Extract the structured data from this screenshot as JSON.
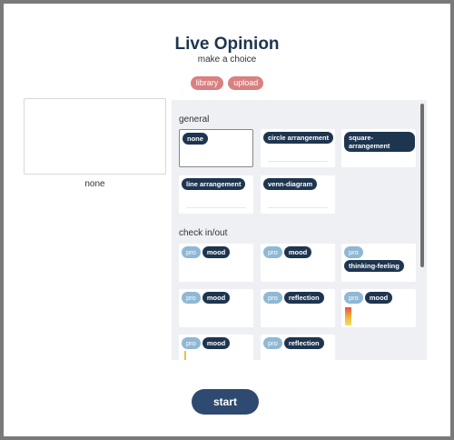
{
  "app": {
    "title": "Live Opinion",
    "subtitle": "make a choice"
  },
  "source_tabs": [
    "library",
    "upload"
  ],
  "preview": {
    "label": "none"
  },
  "sections": [
    {
      "title": "general",
      "cards": [
        {
          "tags": [
            "none"
          ],
          "selected": true
        },
        {
          "tags": [
            "circle arrangement"
          ]
        },
        {
          "tags": [
            "square-arrangement"
          ]
        },
        {
          "tags": [
            "line arrangement"
          ]
        },
        {
          "tags": [
            "venn-diagram"
          ]
        }
      ]
    },
    {
      "title": "check in/out",
      "cards": [
        {
          "tags": [
            "pro",
            "mood"
          ]
        },
        {
          "tags": [
            "pro",
            "mood"
          ]
        },
        {
          "tags": [
            "pro",
            "thinking-feeling"
          ]
        },
        {
          "tags": [
            "pro",
            "mood"
          ]
        },
        {
          "tags": [
            "pro",
            "reflection"
          ]
        },
        {
          "tags": [
            "pro",
            "mood"
          ]
        },
        {
          "tags": [
            "pro",
            "mood"
          ]
        },
        {
          "tags": [
            "pro",
            "reflection"
          ]
        }
      ]
    }
  ],
  "actions": {
    "start_label": "start"
  },
  "colors": {
    "accent": "#1e3550",
    "pill": "#d98080",
    "pro": "#8fb8d4",
    "button": "#2e4a70"
  }
}
